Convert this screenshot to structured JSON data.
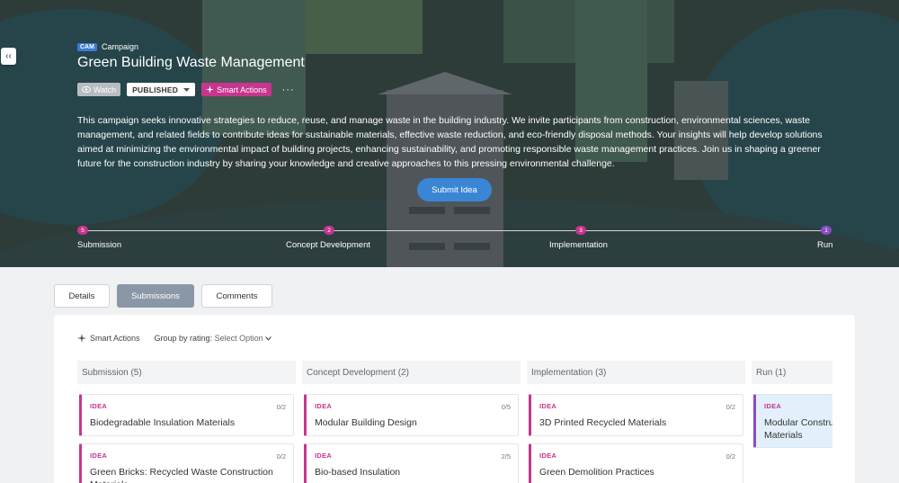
{
  "hero": {
    "badge": "CAM",
    "crumb": "Campaign",
    "title": "Green Building Waste Management",
    "watch_label": "Watch",
    "status_label": "PUBLISHED",
    "smart_actions_label": "Smart Actions",
    "more_label": "···",
    "description": "This campaign seeks innovative strategies to reduce, reuse, and manage waste in the building industry. We invite participants from construction, environmental sciences, waste management, and related fields to contribute ideas for sustainable materials, effective waste reduction, and eco-friendly disposal methods. Your insights will help develop solutions aimed at minimizing the environmental impact of building projects, enhancing sustainability, and promoting responsible waste management practices. Join us in shaping a greener future for the construction industry by sharing your knowledge and creative approaches to this pressing environmental challenge.",
    "submit_label": "Submit Idea",
    "collapse_label": "‹‹"
  },
  "stages": [
    {
      "count": "5",
      "label": "Submission"
    },
    {
      "count": "2",
      "label": "Concept Development"
    },
    {
      "count": "3",
      "label": "Implementation"
    },
    {
      "count": "1",
      "label": "Run"
    }
  ],
  "tabs": [
    "Details",
    "Submissions",
    "Comments"
  ],
  "toolbar": {
    "smart_actions": "Smart Actions",
    "group_label": "Group by rating:",
    "group_value": "Select Option"
  },
  "columns": [
    {
      "header": "Submission (5)"
    },
    {
      "header": "Concept Development (2)"
    },
    {
      "header": "Implementation (3)"
    },
    {
      "header": "Run (1)"
    }
  ],
  "cards": [
    {
      "tag": "IDEA",
      "count": "0/2",
      "title": "Biodegradable Insulation Materials"
    },
    {
      "tag": "IDEA",
      "count": "0/2",
      "title": "Green Bricks: Recycled Waste Construction Materials"
    },
    {
      "tag": "IDEA",
      "count": "0/5",
      "title": "Modular Building Design"
    },
    {
      "tag": "IDEA",
      "count": "2/5",
      "title": "Bio-based Insulation"
    },
    {
      "tag": "IDEA",
      "count": "0/2",
      "title": "3D Printed Recycled Materials"
    },
    {
      "tag": "IDEA",
      "count": "0/2",
      "title": "Green Demolition Practices"
    },
    {
      "tag": "IDEA",
      "count": "",
      "title": "Modular Construction Materials"
    }
  ],
  "colors": {
    "accent_pink": "#c7358e",
    "accent_purple": "#8e4bc4",
    "primary_blue": "#3a86d4"
  }
}
